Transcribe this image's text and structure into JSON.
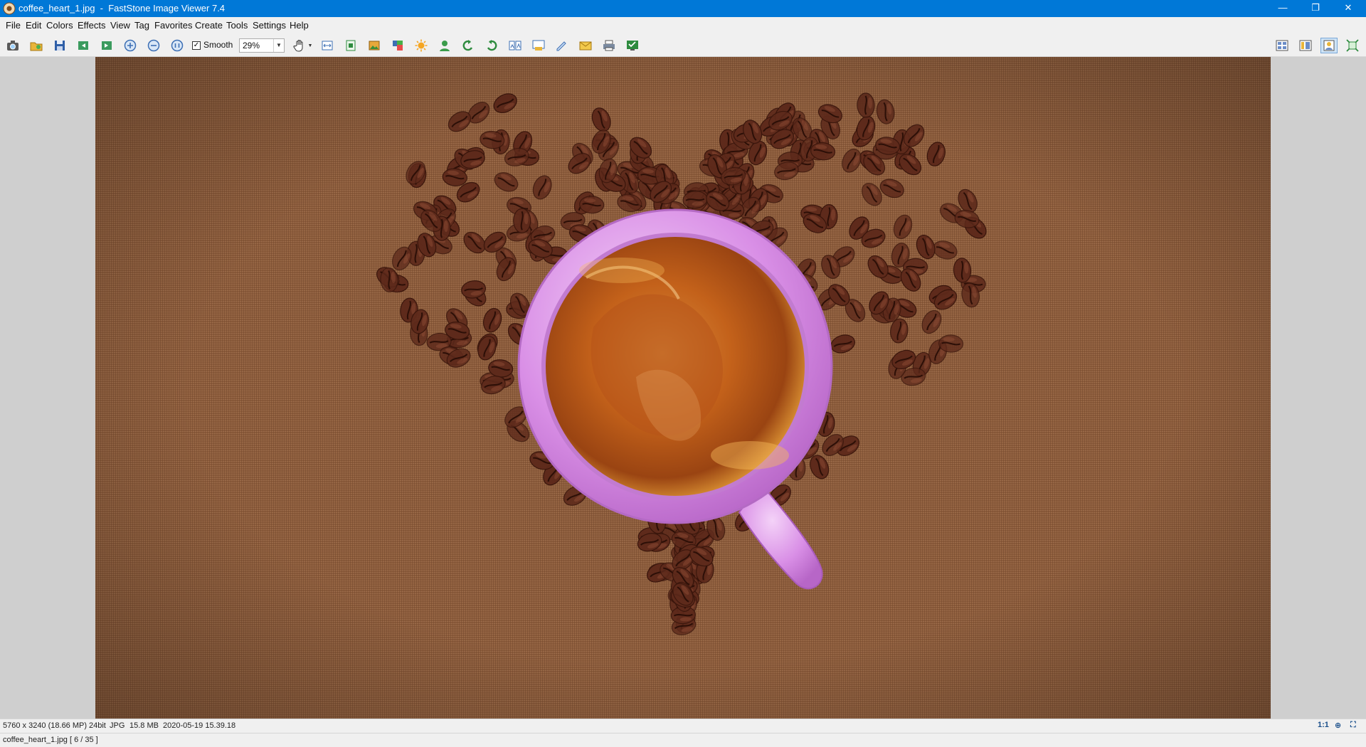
{
  "window": {
    "title": "coffee_heart_1.jpg  -  FastStone Image Viewer 7.4",
    "minimize": "—",
    "restore": "❐",
    "close": "✕"
  },
  "menu": [
    "File",
    "Edit",
    "Colors",
    "Effects",
    "View",
    "Tag",
    "Favorites",
    "Create",
    "Tools",
    "Settings",
    "Help"
  ],
  "toolbar": {
    "smooth_label": "Smooth",
    "smooth_checked": true,
    "zoom_value": "29%",
    "icons": [
      "camera-open-icon",
      "open-folder-icon",
      "save-icon",
      "previous-icon",
      "next-icon",
      "zoom-in-icon",
      "zoom-out-icon",
      "actual-size-icon",
      "hand-pan-icon",
      "resize-icon",
      "crop-icon",
      "canvas-icon",
      "color-adjust-icon",
      "brightness-icon",
      "red-eye-icon",
      "rotate-left-icon",
      "rotate-right-icon",
      "compare-icon",
      "slideshow-icon",
      "draw-icon",
      "email-icon",
      "print-icon",
      "wallpaper-icon",
      "layout-thumbnails-icon",
      "layout-browser-icon",
      "layout-viewer-icon",
      "fullscreen-icon"
    ]
  },
  "image": {
    "file": "coffee_heart_1.jpg",
    "colors": {
      "burlap": "#8a5a3a",
      "bean": "#5e2a1b",
      "cup": "#d98fe6",
      "coffee": "#c3611a"
    }
  },
  "status": {
    "dimensions": "5760 x 3240 (18.66 MP)",
    "bitdepth": "24bit",
    "format": "JPG",
    "filesize": "15.8 MB",
    "date": "2020-05-19 15.39.18",
    "ratio_button": "1:1",
    "file_position": "coffee_heart_1.jpg [ 6 / 35 ]"
  }
}
